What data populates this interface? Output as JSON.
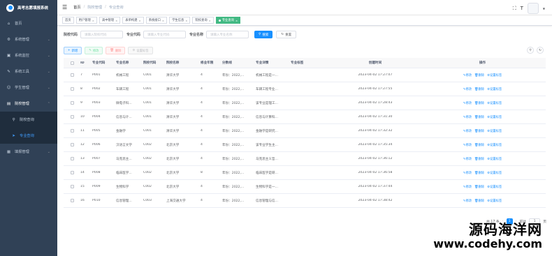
{
  "app": {
    "title": "高考志愿填报系统"
  },
  "sidebar": {
    "items": [
      {
        "icon": "home-icon",
        "glyph": "⌂",
        "label": "首页",
        "chevron": false
      },
      {
        "icon": "gear-icon",
        "glyph": "⚙",
        "label": "系统管理",
        "chevron": true
      },
      {
        "icon": "monitor-icon",
        "glyph": "▣",
        "label": "系统监控",
        "chevron": true
      },
      {
        "icon": "tool-icon",
        "glyph": "✎",
        "label": "系统工具",
        "chevron": true
      },
      {
        "icon": "user-icon",
        "glyph": "☺",
        "label": "学生管理",
        "chevron": true
      },
      {
        "icon": "school-icon",
        "glyph": "▤",
        "label": "院校管理",
        "chevron": true
      }
    ],
    "submenu": [
      {
        "icon": "search-icon",
        "glyph": "⚲",
        "label": "院校查询"
      },
      {
        "icon": "send-icon",
        "glyph": "➤",
        "label": "专业查询"
      }
    ],
    "last_item": {
      "icon": "edit-icon",
      "glyph": "▦",
      "label": "填报管理"
    }
  },
  "navbar": {
    "breadcrumb": [
      "首页",
      "院校管理",
      "专业查询"
    ],
    "fullscreen_glyph": "⛶",
    "size_glyph": "T"
  },
  "tags": [
    {
      "label": "首页",
      "closable": false,
      "active": false
    },
    {
      "label": "用户管理",
      "closable": true,
      "active": false
    },
    {
      "label": "高中管理",
      "closable": true,
      "active": false
    },
    {
      "label": "表单构建",
      "closable": true,
      "active": false
    },
    {
      "label": "系统接口",
      "closable": true,
      "active": false
    },
    {
      "label": "学生信息",
      "closable": true,
      "active": false
    },
    {
      "label": "院校查询",
      "closable": true,
      "active": false
    },
    {
      "label": "专业查询",
      "closable": true,
      "active": true
    }
  ],
  "search": {
    "school_code_label": "院校代码",
    "school_code_placeholder": "请输入院校代码",
    "major_code_label": "专业代码",
    "major_code_placeholder": "请输入专业代码",
    "major_name_label": "专业名称",
    "major_name_placeholder": "请输入专业名称",
    "search_label": "搜索",
    "reset_label": "重置"
  },
  "toolbar": {
    "add_label": "新增",
    "edit_label": "修改",
    "delete_label": "删除",
    "tags_label": "设置标签"
  },
  "table": {
    "headers": [
      "ID",
      "专业代码",
      "专业名称",
      "院校代码",
      "院校名称",
      "修业年限",
      "分数线",
      "专业详情",
      "专业标签",
      "创建时间",
      "操作"
    ],
    "rows": [
      [
        "7",
        "P001",
        "机械工程",
        "C001",
        "清华大学",
        "4",
        "年份：2022,...",
        "机械工程是一...",
        "",
        "2023-04-02 17:27:07"
      ],
      [
        "8",
        "P002",
        "车辆工程",
        "C001",
        "清华大学",
        "4",
        "年份：2022,...",
        "车辆工程专业...",
        "",
        "2023-04-02 17:27:55"
      ],
      [
        "9",
        "P003",
        "微电子科...",
        "C001",
        "清华大学",
        "4",
        "年份：2022,...",
        "该专业是理工...",
        "",
        "2023-04-02 17:28:43"
      ],
      [
        "10",
        "P004",
        "信息与计...",
        "C001",
        "清华大学",
        "4",
        "年份：2022,...",
        "信息与计算科...",
        "",
        "2023-04-02 17:31:30"
      ],
      [
        "11",
        "P005",
        "金融学",
        "C001",
        "清华大学",
        "4",
        "年份：2022,...",
        "金融学是研究...",
        "",
        "2023-04-02 17:32:32"
      ],
      [
        "12",
        "P006",
        "汉语言文学",
        "C002",
        "北京大学",
        "4",
        "年份：2022,...",
        "该专业学生主...",
        "",
        "2023-04-02 17:35:34"
      ],
      [
        "13",
        "P007",
        "马克思主...",
        "C002",
        "北京大学",
        "4",
        "年份：2022,...",
        "马克思主义哲...",
        "",
        "2023-04-02 17:36:12"
      ],
      [
        "14",
        "P008",
        "临床医学...",
        "C002",
        "北京大学",
        "8",
        "年份：2022,...",
        "临床医学是研...",
        "",
        "2023-04-02 17:36:58"
      ],
      [
        "15",
        "P009",
        "生物科学",
        "C002",
        "北京大学",
        "4",
        "年份：2022,...",
        "生物科学是一...",
        "",
        "2023-04-02 17:37:44"
      ],
      [
        "16",
        "P010",
        "信息管理...",
        "C003",
        "上海交通大学",
        "4",
        "年份：2022,...",
        "信息管理与信...",
        "",
        "2023-04-02 17:38:42"
      ]
    ],
    "op_edit": "修改",
    "op_delete": "删除",
    "op_tags": "设置标签"
  },
  "pager": {
    "total": "共 17 条",
    "current_page": "1",
    "goto_label": "前往",
    "goto_value": "1",
    "page_suffix": "页"
  },
  "watermark": {
    "line1": "源码海洋网",
    "line2": "www.codehy.com"
  },
  "colors": {
    "sidebar_bg": "#304156",
    "primary": "#1890ff",
    "active_tag": "#42b983"
  }
}
